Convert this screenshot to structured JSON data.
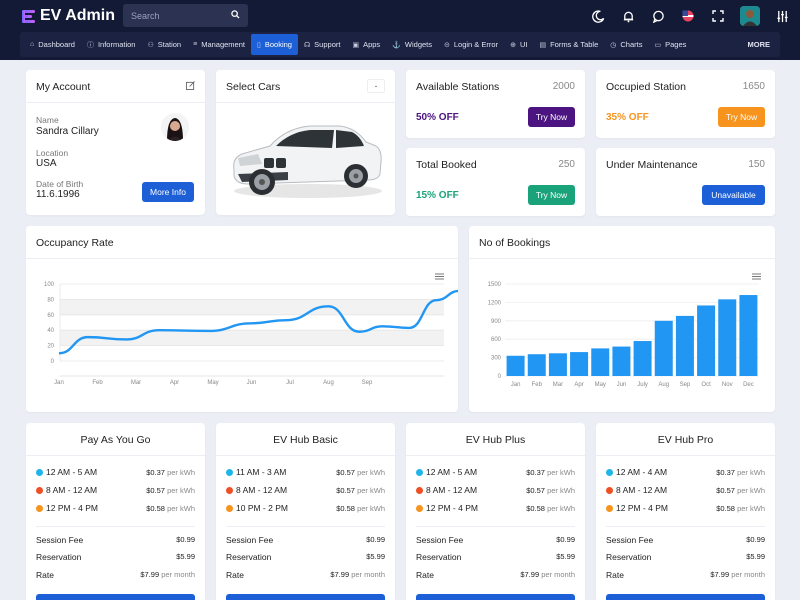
{
  "app": {
    "title": "EV Admin"
  },
  "search": {
    "placeholder": "Search"
  },
  "header_icons": [
    "moon-icon",
    "bell-icon",
    "chat-icon",
    "flag-icon",
    "fullscreen-icon",
    "user-avatar",
    "settings-sliders-icon"
  ],
  "nav": {
    "items": [
      {
        "label": "Dashboard",
        "icon": "home-icon"
      },
      {
        "label": "Information",
        "icon": "info-icon"
      },
      {
        "label": "Station",
        "icon": "station-icon"
      },
      {
        "label": "Management",
        "icon": "list-icon"
      },
      {
        "label": "Booking",
        "icon": "booking-icon",
        "active": true
      },
      {
        "label": "Support",
        "icon": "headset-icon"
      },
      {
        "label": "Apps",
        "icon": "apps-icon"
      },
      {
        "label": "Widgets",
        "icon": "widgets-icon"
      },
      {
        "label": "Login & Error",
        "icon": "lock-icon"
      },
      {
        "label": "UI",
        "icon": "ui-icon"
      },
      {
        "label": "Forms & Table",
        "icon": "table-icon"
      },
      {
        "label": "Charts",
        "icon": "chart-icon"
      },
      {
        "label": "Pages",
        "icon": "pages-icon"
      }
    ],
    "more": "MORE"
  },
  "account": {
    "title": "My Account",
    "name_label": "Name",
    "name": "Sandra Cillary",
    "location_label": "Location",
    "location": "USA",
    "dob_label": "Date of Birth",
    "dob": "11.6.1996",
    "button": "More Info"
  },
  "cars": {
    "title": "Select Cars",
    "selected": "-"
  },
  "stats": {
    "available": {
      "title": "Available Stations",
      "value": "2000",
      "offer": "50% OFF",
      "button": "Try Now",
      "color": "#4b1480"
    },
    "occupied": {
      "title": "Occupied Station",
      "value": "1650",
      "offer": "35% OFF",
      "button": "Try Now",
      "color": "#f7941d"
    },
    "booked": {
      "title": "Total Booked",
      "value": "250",
      "offer": "15% OFF",
      "button": "Try Now",
      "color": "#1aa37a"
    },
    "maintenance": {
      "title": "Under Maintenance",
      "value": "150",
      "button": "Unavailable",
      "color": "#1d5fd6"
    }
  },
  "occupancy": {
    "title": "Occupancy Rate",
    "chart_data": {
      "type": "line",
      "title": "Occupancy Rate",
      "categories": [
        "Jan",
        "Feb",
        "Mar",
        "Apr",
        "May",
        "Jun",
        "Jul",
        "Aug",
        "Sep",
        "Oct",
        "Nov",
        "Dec"
      ],
      "values": [
        10,
        31,
        28,
        40,
        39,
        49,
        53,
        71,
        38,
        45,
        43,
        79,
        91,
        94
      ],
      "x_points": [
        0,
        0.75,
        1.75,
        2.6,
        3.9,
        5.0,
        5.9,
        7.0,
        7.8,
        8.4,
        9.1,
        9.8,
        10.4,
        10.9
      ],
      "yticks": [
        0,
        20,
        40,
        60,
        80,
        100
      ],
      "ylim": [
        0,
        100
      ],
      "color": "#2196f3",
      "xlabels_shown": [
        "Jan",
        "Feb",
        "Mar",
        "Apr",
        "May",
        "Jun",
        "Jul",
        "Aug",
        "Sep"
      ]
    }
  },
  "bookings": {
    "title": "No of Bookings",
    "chart_data": {
      "type": "bar",
      "title": "No of Bookings",
      "categories": [
        "Jan",
        "Feb",
        "Mar",
        "Apr",
        "May",
        "Jun",
        "July",
        "Aug",
        "Sep",
        "Oct",
        "Nov",
        "Dec"
      ],
      "values": [
        330,
        355,
        370,
        390,
        450,
        480,
        570,
        900,
        980,
        1150,
        1250,
        1320
      ],
      "yticks": [
        0,
        300,
        600,
        900,
        1200,
        1500
      ],
      "ylim": [
        0,
        1500
      ],
      "color": "#2196f3"
    }
  },
  "plans": [
    {
      "title": "Pay As You Go",
      "slots": [
        {
          "time": "12 AM - 5 AM",
          "price": "$0.37",
          "unit": "per kWh",
          "color": "#1eb6e8"
        },
        {
          "time": "8 AM - 12 AM",
          "price": "$0.57",
          "unit": "per kWh",
          "color": "#f04e23"
        },
        {
          "time": "12 PM - 4 PM",
          "price": "$0.58",
          "unit": "per kWh",
          "color": "#f7941d"
        }
      ],
      "session_fee": "$0.99",
      "reservation": "$5.99",
      "rate": "$7.99",
      "rate_unit": "per month"
    },
    {
      "title": "EV Hub Basic",
      "slots": [
        {
          "time": "11 AM - 3 AM",
          "price": "$0.57",
          "unit": "per kWh",
          "color": "#1eb6e8"
        },
        {
          "time": "8 AM - 12 AM",
          "price": "$0.57",
          "unit": "per kWh",
          "color": "#f04e23"
        },
        {
          "time": "10 PM - 2 PM",
          "price": "$0.58",
          "unit": "per kWh",
          "color": "#f7941d"
        }
      ],
      "session_fee": "$0.99",
      "reservation": "$5.99",
      "rate": "$7.99",
      "rate_unit": "per month"
    },
    {
      "title": "EV Hub Plus",
      "slots": [
        {
          "time": "12 AM - 5 AM",
          "price": "$0.37",
          "unit": "per kWh",
          "color": "#1eb6e8"
        },
        {
          "time": "8 AM - 12 AM",
          "price": "$0.57",
          "unit": "per kWh",
          "color": "#f04e23"
        },
        {
          "time": "12 PM - 4 PM",
          "price": "$0.58",
          "unit": "per kWh",
          "color": "#f7941d"
        }
      ],
      "session_fee": "$0.99",
      "reservation": "$5.99",
      "rate": "$7.99",
      "rate_unit": "per month"
    },
    {
      "title": "EV Hub Pro",
      "slots": [
        {
          "time": "12 AM - 4 AM",
          "price": "$0.37",
          "unit": "per kWh",
          "color": "#1eb6e8"
        },
        {
          "time": "8 AM - 12 AM",
          "price": "$0.57",
          "unit": "per kWh",
          "color": "#f04e23"
        },
        {
          "time": "12 PM - 4 PM",
          "price": "$0.58",
          "unit": "per kWh",
          "color": "#f7941d"
        }
      ],
      "session_fee": "$0.99",
      "reservation": "$5.99",
      "rate": "$7.99",
      "rate_unit": "per month"
    }
  ],
  "plan_labels": {
    "session_fee": "Session Fee",
    "reservation": "Reservation",
    "rate": "Rate"
  }
}
